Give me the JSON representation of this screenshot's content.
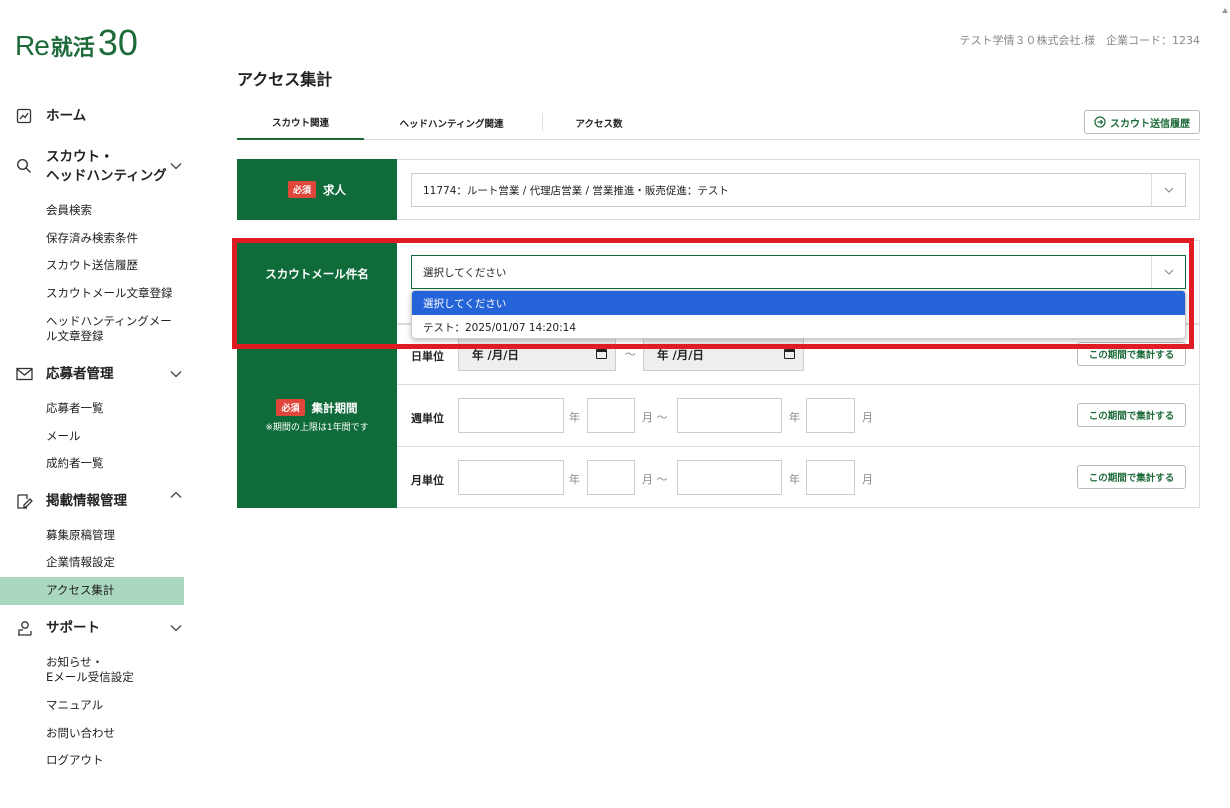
{
  "logo": {
    "re": "Re",
    "kj": "就活",
    "num": "30"
  },
  "header": {
    "company": "テスト学情３０株式会社.様　企業コード：1234",
    "page_title": "アクセス集計"
  },
  "sidebar": {
    "home": "ホーム",
    "scout_line1": "スカウト・",
    "scout_line2": "ヘッドハンティング",
    "scout_items": [
      "会員検索",
      "保存済み検索条件",
      "スカウト送信履歴",
      "スカウトメール文章登録",
      "ヘッドハンティングメー",
      "ル文章登録"
    ],
    "applicants": "応募者管理",
    "applicant_items": [
      "応募者一覧",
      "メール",
      "成約者一覧"
    ],
    "posting": "掲載情報管理",
    "posting_items": [
      "募集原稿管理",
      "企業情報設定",
      "アクセス集計"
    ],
    "support": "サポート",
    "support_items": [
      "お知らせ・",
      "Eメール受信設定",
      "マニュアル",
      "お問い合わせ",
      "ログアウト"
    ]
  },
  "tabs": [
    "スカウト関連",
    "ヘッドハンティング関連",
    "アクセス数"
  ],
  "history_button": "スカウト送信履歴",
  "form": {
    "required": "必須",
    "job_label": "求人",
    "job_value": "11774：ルート営業 / 代理店営業 / 営業推進・販売促進：テスト",
    "mail_label": "スカウトメール件名",
    "mail_value": "選択してください",
    "period_label": "集計期間",
    "period_note": "※期間の上限は1年間です",
    "day_unit": "日単位",
    "week_unit": "週単位",
    "month_unit": "月単位",
    "date_placeholder": "年 /月/日",
    "tilde": "～",
    "year": "年",
    "month": "月",
    "month_tilde": "月 ～",
    "aggregate_button": "この期間で集計する"
  },
  "dropdown": {
    "options": [
      "選択してください",
      "テスト：2025/01/07 14:20:14"
    ]
  },
  "colors": {
    "brand": "#0f6b3a",
    "required": "#e0473b",
    "active_nav": "#a9d8bf",
    "selected_option": "#2563d9",
    "highlight": "#e01b24"
  }
}
